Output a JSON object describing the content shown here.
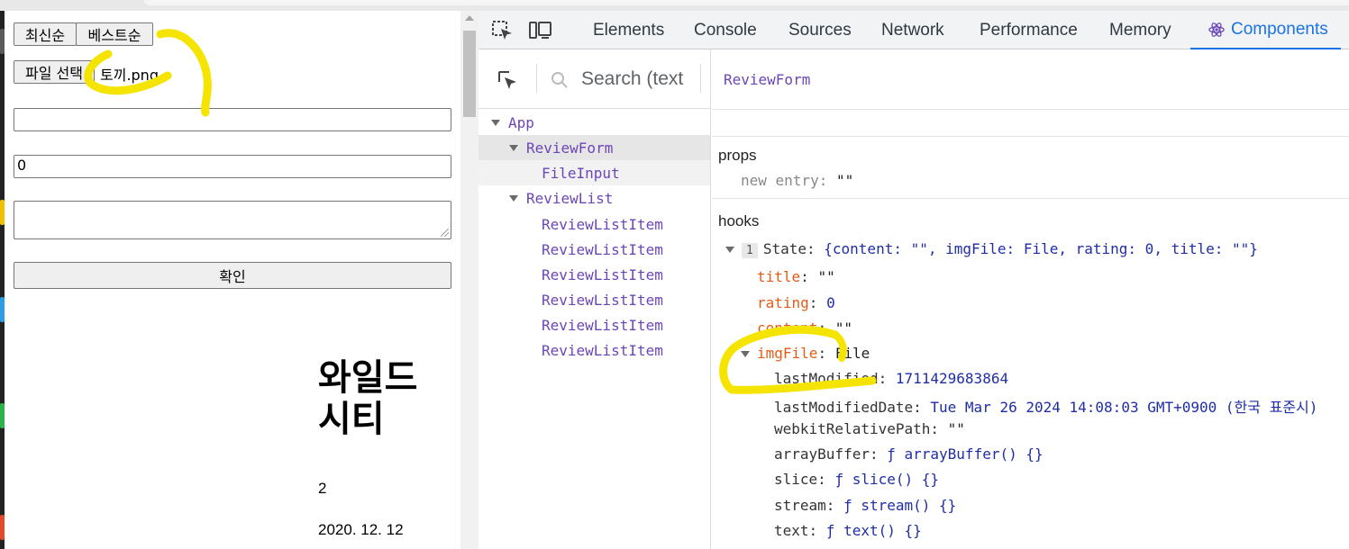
{
  "colors": {
    "annotation": "#f5e400",
    "react_accent": "#1a73e8",
    "component_name": "#6c46b8"
  },
  "app": {
    "sort_latest": "최신순",
    "sort_best": "베스트순",
    "file_button": "파일 선택",
    "file_name": "토끼.png",
    "title_value": "",
    "rating_value": "0",
    "content_value": "",
    "submit": "확인",
    "review": {
      "title": "와일드 시티",
      "rating": "2",
      "date": "2020. 12. 12"
    }
  },
  "devtools": {
    "tabs": [
      "Elements",
      "Console",
      "Sources",
      "Network",
      "Performance",
      "Memory",
      "Components"
    ],
    "active_tab": "Components",
    "search_placeholder": "Search (text",
    "tree": {
      "app": "App",
      "review_form": "ReviewForm",
      "file_input": "FileInput",
      "review_list": "ReviewList",
      "items": [
        "ReviewListItem",
        "ReviewListItem",
        "ReviewListItem",
        "ReviewListItem",
        "ReviewListItem",
        "ReviewListItem"
      ]
    },
    "selected_component": "ReviewForm",
    "props": {
      "label": "props",
      "key": "new entry",
      "value": "\"\""
    },
    "hooks": {
      "label": "hooks",
      "badge": "1",
      "state_key": "State",
      "state_summary": "{content: \"\", imgFile: File, rating: 0, title: \"\"}",
      "title_key": "title",
      "title_val": "\"\"",
      "rating_key": "rating",
      "rating_val": "0",
      "content_key": "content",
      "content_val": "\"\"",
      "imgfile_key": "imgFile",
      "imgfile_val": "File",
      "file_props": [
        {
          "k": "lastModified",
          "v": "1711429683864"
        },
        {
          "k": "lastModifiedDate",
          "v": "Tue Mar 26 2024 14:08:03 GMT+0900 (한국 표준시)"
        },
        {
          "k": "webkitRelativePath",
          "v": "\"\""
        },
        {
          "k": "arrayBuffer",
          "v": "ƒ arrayBuffer() {}"
        },
        {
          "k": "slice",
          "v": "ƒ slice() {}"
        },
        {
          "k": "stream",
          "v": "ƒ stream() {}"
        },
        {
          "k": "text",
          "v": "ƒ text() {}"
        }
      ]
    }
  }
}
